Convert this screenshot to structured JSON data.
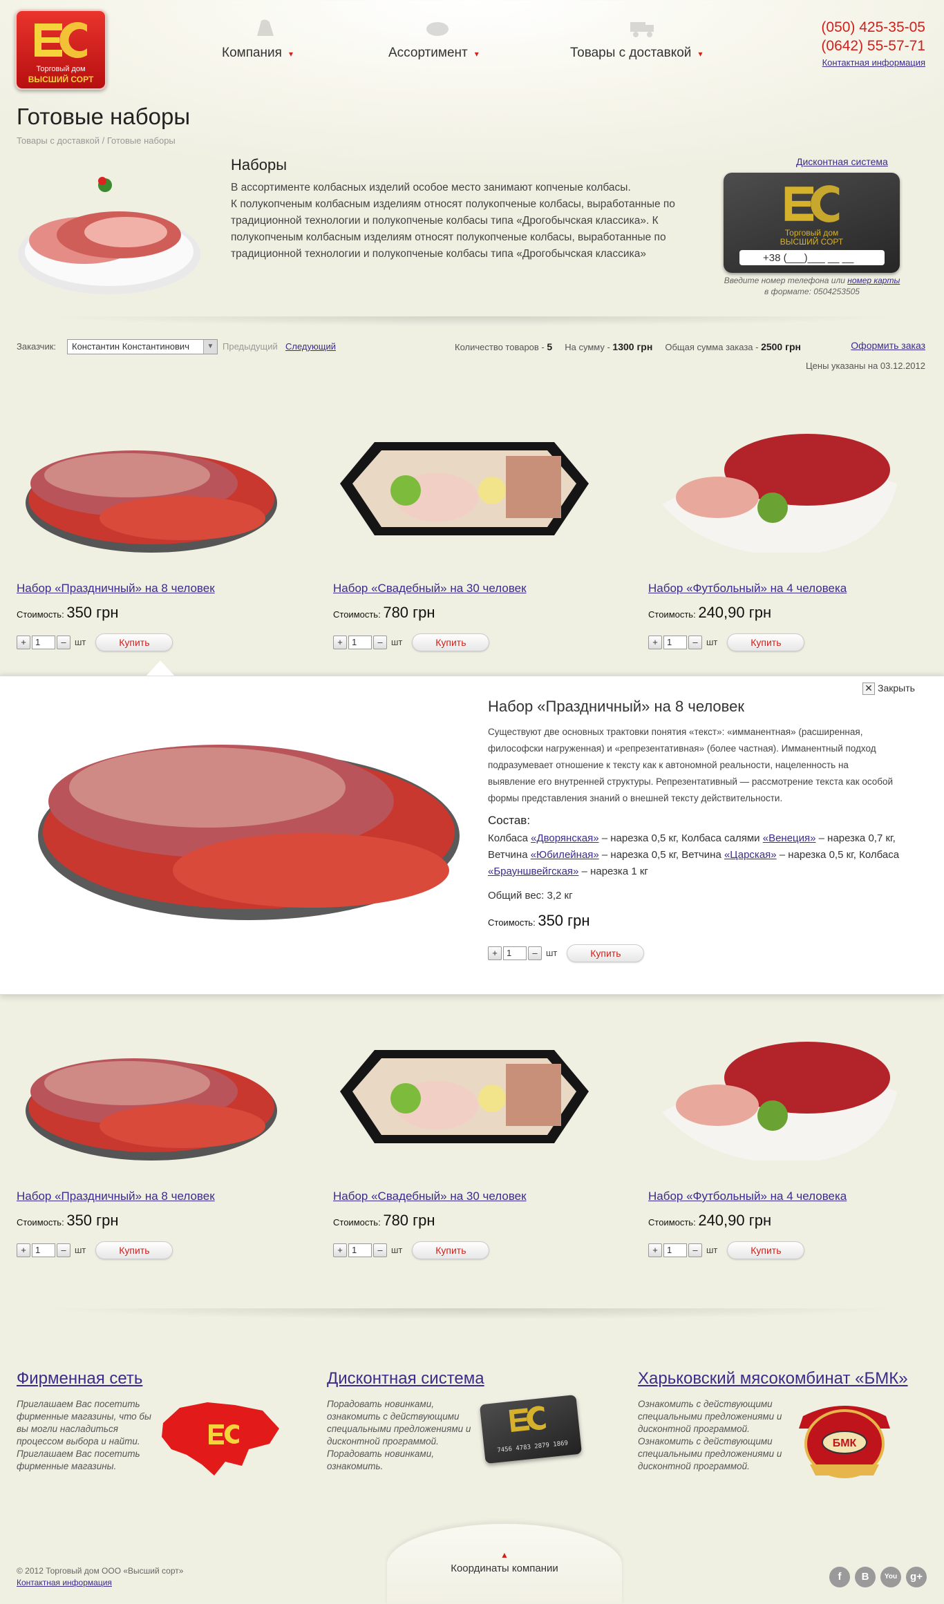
{
  "header": {
    "logo_line1": "Торговый дом",
    "logo_line2": "ВЫСШИЙ СОРТ",
    "nav": [
      {
        "label": "Компания"
      },
      {
        "label": "Ассортимент"
      },
      {
        "label": "Товары с доставкой"
      }
    ],
    "phone1": "(050) 425-35-05",
    "phone2": "(0642) 55-57-71",
    "contacts_link": "Контактная информация"
  },
  "page": {
    "title": "Готовые наборы",
    "breadcrumb": "Товары с доставкой / Готовые наборы"
  },
  "intro": {
    "title": "Наборы",
    "text": "В ассортименте колбасных изделий особое место занимают копченые колбасы.\nК полукопченым колбасным изделиям относят полукопченые колбасы, выработанные по традиционной технологии и полукопченые колбасы типа «Дрогобычская классика». К полукопченым колбасным изделиям относят полукопченые колбасы, выработанные по традиционной технологии и полукопченые колбасы типа «Дрогобычская классика»"
  },
  "discount": {
    "link": "Дисконтная система",
    "card_line1": "Торговый дом",
    "card_line2": "ВЫСШИЙ СОРТ",
    "phone_value": "+38 (___)___ __ __",
    "hint1": "Введите номер телефона или",
    "hint_link": "номер карты",
    "hint2": "в формате: 0504253505"
  },
  "order": {
    "customer_label": "Заказчик:",
    "customer_value": "Константин Константинович",
    "prev": "Предыдущий",
    "next": "Следующий",
    "count_label": "Количество товаров -",
    "count": "5",
    "sum_label": "На сумму -",
    "sum": "1300 грн",
    "total_label": "Общая сумма заказа -",
    "total": "2500 грн",
    "checkout": "Оформить заказ",
    "price_date": "Цены указаны на 03.12.2012"
  },
  "products": [
    {
      "title": "Набор «Праздничный» на 8 человек",
      "cost_label": "Стоимость:",
      "price": "350 грн",
      "qty": "1",
      "unit": "шт",
      "buy": "Купить",
      "plus": "+",
      "minus": "–"
    },
    {
      "title": "Набор «Свадебный» на 30 человек",
      "cost_label": "Стоимость:",
      "price": "780 грн",
      "qty": "1",
      "unit": "шт",
      "buy": "Купить",
      "plus": "+",
      "minus": "–"
    },
    {
      "title": "Набор «Футбольный» на 4 человека",
      "cost_label": "Стоимость:",
      "price": "240,90 грн",
      "qty": "1",
      "unit": "шт",
      "buy": "Купить",
      "plus": "+",
      "minus": "–"
    }
  ],
  "detail": {
    "close": "Закрыть",
    "title": "Набор «Праздничный» на 8 человек",
    "description": "Существуют две основных трактовки понятия «текст»: «имманентная» (расширенная, философски нагруженная) и «репрезентативная» (более частная). Имманентный подход подразумевает отношение к тексту как к автономной реальности, нацеленность на выявление его внутренней структуры. Репрезентативный — рассмотрение текста как особой формы представления знаний о внешней тексту действительности.",
    "composition_label": "Состав:",
    "composition": [
      {
        "pre": "Колбаса ",
        "link": "«Дворянская»",
        "post": " – нарезка 0,5 кг, "
      },
      {
        "pre": "Колбаса салями ",
        "link": "«Венеция»",
        "post": " – нарезка 0,7 кг, "
      },
      {
        "pre": "Ветчина ",
        "link": "«Юбилейная»",
        "post": " – нарезка 0,5 кг, "
      },
      {
        "pre": "Ветчина ",
        "link": "«Царская»",
        "post": " – нарезка 0,5 кг, "
      },
      {
        "pre": "Колбаса ",
        "link": "«Брауншвейгская»",
        "post": " – нарезка 1 кг"
      }
    ],
    "weight": "Общий вес: 3,2 кг",
    "cost_label": "Стоимость:",
    "price": "350 грн",
    "qty": "1",
    "unit": "шт",
    "buy": "Купить",
    "plus": "+",
    "minus": "–"
  },
  "footer": {
    "blocks": [
      {
        "title": "Фирменная сеть",
        "text": "Приглашаем Вас посетить фирменные магазины, что бы вы могли насладиться процессом выбора и найти. Приглашаем Вас посетить фирменные магазины."
      },
      {
        "title": "Дисконтная система",
        "text": "Порадовать новинками, ознакомить с действующими специальными предложениями и дисконтной программой. Порадовать новинками, ознакомить."
      },
      {
        "title": "Харьковский мясокомбинат «БМК»",
        "text": "Ознакомить с действующими специальными предложениями и дисконтной программой. Ознакомить с действующими специальными предложениями и дисконтной программой."
      }
    ],
    "card_number": "7456 4783 2879 1869",
    "bmk_text": "БМК",
    "coordinates": "Координаты компании",
    "copyright": "© 2012 Торговый дом ООО «Высший сорт»",
    "contacts_link": "Контактная информация",
    "social": [
      "f",
      "B",
      "You",
      "g+"
    ]
  },
  "colors": {
    "accent_red": "#d0201c",
    "link": "#3b2c8a",
    "gold": "#d6b22c"
  }
}
